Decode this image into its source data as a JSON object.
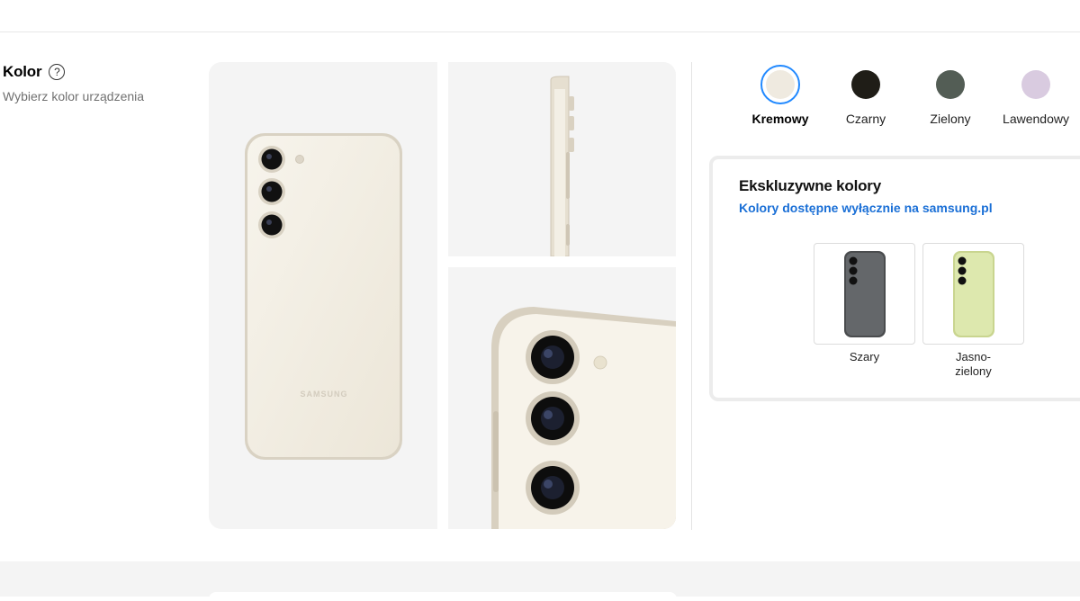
{
  "section": {
    "title": "Kolor",
    "help_icon": "question-circle-icon",
    "subtitle": "Wybierz kolor urządzenia"
  },
  "gallery": {
    "brand_print": "SAMSUNG"
  },
  "colors": {
    "selected": "Kremowy",
    "options": [
      {
        "label": "Kremowy",
        "hex": "#efeae0",
        "selected": true
      },
      {
        "label": "Czarny",
        "hex": "#1f1d17",
        "selected": false
      },
      {
        "label": "Zielony",
        "hex": "#535d55",
        "selected": false
      },
      {
        "label": "Lawendowy",
        "hex": "#d9cbe0",
        "selected": false
      }
    ]
  },
  "exclusive": {
    "title": "Ekskluzywne kolory",
    "link": "Kolory dostępne wyłącznie na samsung.pl",
    "items": [
      {
        "label": "Szary",
        "hex": "#5f6163"
      },
      {
        "label_line1": "Jasno-",
        "label_line2": "zielony",
        "hex": "#dde8ae"
      }
    ]
  },
  "accent_color": "#2189ff",
  "link_color": "#1a6fd6"
}
